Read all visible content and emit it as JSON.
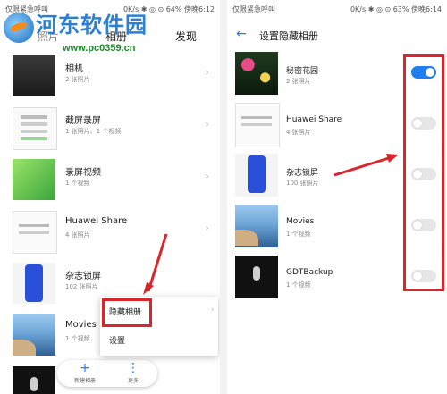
{
  "watermark": {
    "title": "河东软件园",
    "url": "www.pc0359.cn"
  },
  "left": {
    "status": {
      "carrier": "仅限紧急呼叫",
      "right": "0K/s ✱ ◎ ⊙ 64% 傍晚6:12"
    },
    "tabs": {
      "photos": "照片",
      "albums": "相册",
      "discover": "发现"
    },
    "albums": [
      {
        "name": "相机",
        "count": "2 张照片",
        "thumb": "keyboard"
      },
      {
        "name": "截屏录屏",
        "count": "1 张照片、1 个视频",
        "thumb": "screen"
      },
      {
        "name": "录屏视频",
        "count": "1 个视频",
        "thumb": "green"
      },
      {
        "name": "Huawei Share",
        "count": "4 张照片",
        "thumb": "share"
      },
      {
        "name": "杂志锁屏",
        "count": "102 张照片",
        "thumb": "blue"
      },
      {
        "name": "Movies",
        "count": "1 个视频",
        "thumb": "sea"
      },
      {
        "name": "",
        "count": "",
        "thumb": "dark"
      }
    ],
    "popup": {
      "hidden_albums": "隐藏相册",
      "settings": "设置"
    },
    "bottom": {
      "new_album": "新建相册",
      "more": "更多",
      "new_icon": "plus-icon",
      "more_icon": "more-vertical-icon"
    }
  },
  "right": {
    "status": {
      "carrier": "仅限紧急呼叫",
      "right": "0K/s ✱ ◎ ⊙ 63% 傍晚6:14"
    },
    "title": "设置隐藏相册",
    "albums": [
      {
        "name": "秘密花园",
        "count": "2 张照片",
        "on": true,
        "thumb": "garden"
      },
      {
        "name": "Huawei Share",
        "count": "4 张照片",
        "on": false,
        "thumb": "share"
      },
      {
        "name": "杂志锁屏",
        "count": "100 张照片",
        "on": false,
        "thumb": "blue"
      },
      {
        "name": "Movies",
        "count": "1 个视频",
        "on": false,
        "thumb": "sea"
      },
      {
        "name": "GDTBackup",
        "count": "1 个视频",
        "on": false,
        "thumb": "dark"
      }
    ]
  },
  "colors": {
    "accent": "#1e7ef0",
    "highlight": "#d8262c"
  }
}
